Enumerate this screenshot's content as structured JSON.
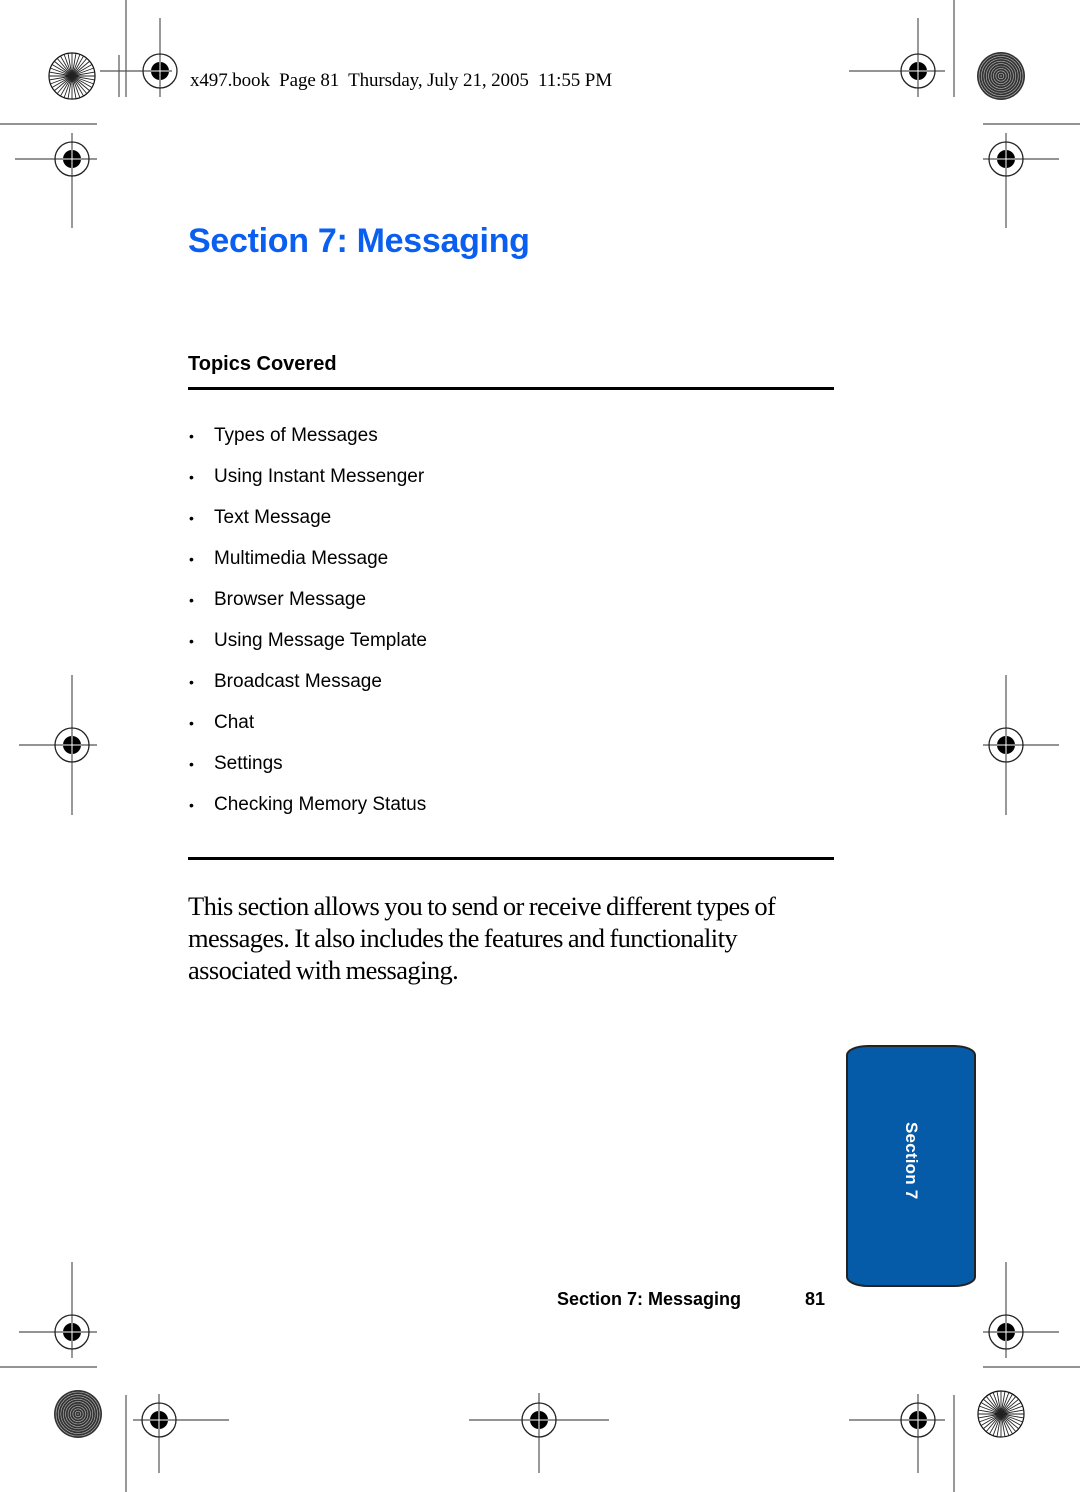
{
  "print_slug": "x497.book  Page 81  Thursday, July 21, 2005  11:55 PM",
  "section_title": "Section 7: Messaging",
  "topics": {
    "heading": "Topics Covered",
    "bullet_glyph": "•",
    "items": [
      "Types of Messages",
      "Using Instant Messenger",
      "Text Message",
      "Multimedia Message",
      "Browser Message",
      "Using Message Template",
      "Broadcast Message",
      "Chat",
      "Settings",
      "Checking Memory Status"
    ]
  },
  "intro_paragraph": "This section allows you to send or receive different types of messages. It also includes the features and functionality associated with messaging.",
  "side_tab": {
    "label": "Section 7",
    "color": "#055ba8"
  },
  "footer": {
    "section_label": "Section 7: Messaging",
    "page_number": "81"
  },
  "colors": {
    "title_blue": "#0a5ef0",
    "text": "#000000"
  },
  "registration_marks": {
    "crosshair_icon": "registration-crosshair-icon",
    "starburst_icon": "starburst-target-icon",
    "concentric_icon": "concentric-target-icon"
  }
}
